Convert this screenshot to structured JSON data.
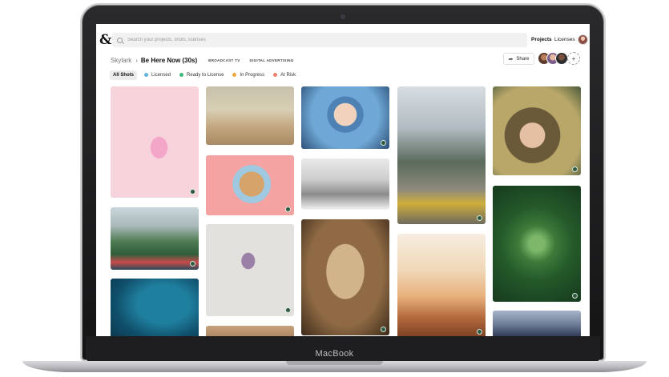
{
  "device": {
    "brand": "MacBook"
  },
  "colors": {
    "licensed": "#5fb6d9",
    "ready_to_license": "#3fb97b",
    "in_progress": "#f2a93b",
    "at_risk": "#ef7e6e",
    "badge": "#2f5a40"
  },
  "header": {
    "logo": "&",
    "search_placeholder": "Search your projects, shots, licenses",
    "nav": {
      "projects": "Projects",
      "licenses": "Licenses"
    }
  },
  "breadcrumb": {
    "project": "Skylark",
    "separator": "›",
    "title": "Be Here Now (30s)",
    "tags": [
      "BROADCAST TV",
      "DIGITAL ADVERTISING"
    ]
  },
  "share": {
    "label": "Share",
    "icon": "share-arrow-icon"
  },
  "collaborators_icon": "add-person-icon",
  "filters": [
    {
      "label": "All Shots",
      "active": true
    },
    {
      "label": "Licensed",
      "color": "#5fb6d9"
    },
    {
      "label": "Ready to License",
      "color": "#3fb97b"
    },
    {
      "label": "In Progress",
      "color": "#f2a93b"
    },
    {
      "label": "At Risk",
      "color": "#ef7e6e"
    }
  ]
}
